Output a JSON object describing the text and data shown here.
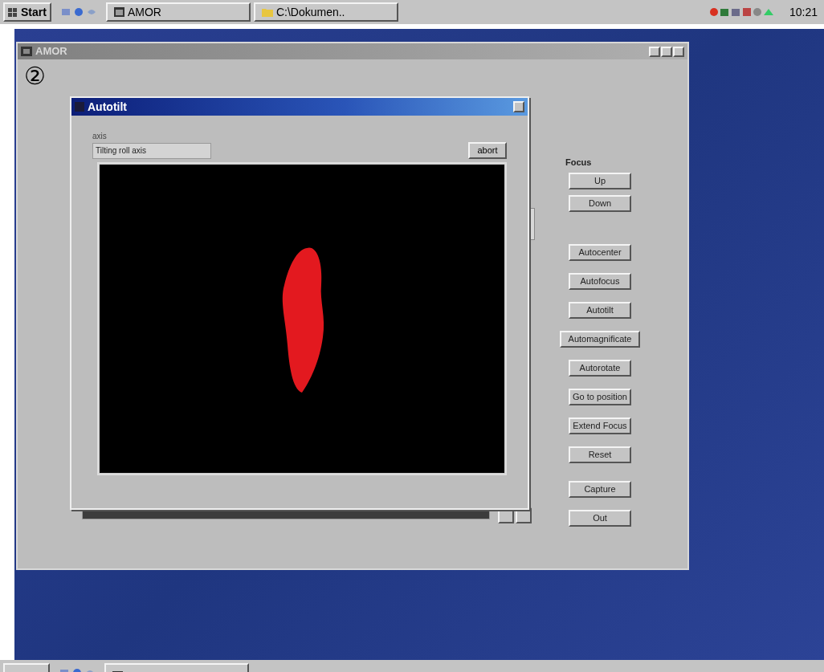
{
  "taskbar_top": {
    "start": "Start",
    "buttons": [
      {
        "label": "AMOR",
        "kind": "window"
      },
      {
        "label": "C:\\Dokumen..",
        "kind": "folder"
      }
    ],
    "clock": "10:21"
  },
  "amor_window": {
    "title": "AMOR",
    "step_marker": "②",
    "focus_label": "Focus",
    "focus_buttons": [
      "Up",
      "Down"
    ],
    "auto_buttons": [
      "Autocenter",
      "Autofocus",
      "Autotilt",
      "Automagnificate",
      "Autorotate",
      "Go to position",
      "Extend Focus",
      "Reset"
    ],
    "action_buttons": [
      "Capture",
      "Out"
    ]
  },
  "autotilt_dialog": {
    "title": "Autotilt",
    "axis_label": "axis",
    "axis_value": "Tilting roll axis",
    "abort_button": "abort"
  },
  "taskbar_bottom": {
    "buttons": [
      {
        "kind": "window"
      }
    ]
  }
}
